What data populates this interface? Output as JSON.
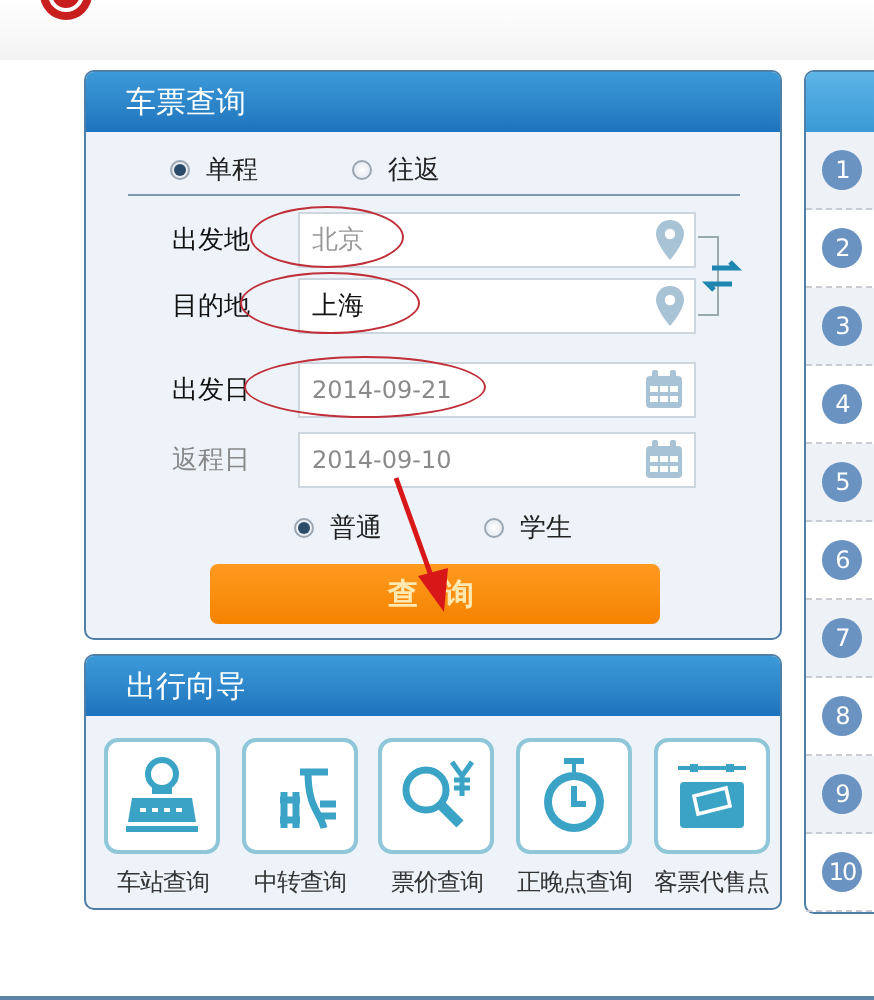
{
  "ticket_search": {
    "title": "车票查询",
    "trip_types": [
      {
        "label": "单程",
        "selected": true
      },
      {
        "label": "往返",
        "selected": false
      }
    ],
    "fields": [
      {
        "label": "出发地",
        "kind": "place",
        "placeholder": "北京",
        "disabled": false,
        "circled": true
      },
      {
        "label": "目的地",
        "kind": "place",
        "value": "上海",
        "disabled": false,
        "circled": true
      },
      {
        "label": "出发日",
        "kind": "date",
        "value": "2014-09-21",
        "disabled": false,
        "circled": true
      },
      {
        "label": "返程日",
        "kind": "date",
        "value": "2014-09-10",
        "disabled": true,
        "circled": false
      }
    ],
    "passenger_types": [
      {
        "label": "普通",
        "selected": true
      },
      {
        "label": "学生",
        "selected": false
      }
    ],
    "search_button": {
      "label": "查 询",
      "pointed": true
    }
  },
  "travel_guide": {
    "title": "出行向导",
    "items": [
      {
        "label": "车站查询",
        "kind": "station"
      },
      {
        "label": "中转查询",
        "kind": "transfer"
      },
      {
        "label": "票价查询",
        "kind": "price"
      },
      {
        "label": "正晚点查询",
        "kind": "clock"
      },
      {
        "label": "客票代售点",
        "kind": "agency"
      }
    ]
  },
  "ranking": {
    "numbers": [
      "1",
      "2",
      "3",
      "4",
      "5",
      "6",
      "7",
      "8",
      "9",
      "10"
    ]
  }
}
